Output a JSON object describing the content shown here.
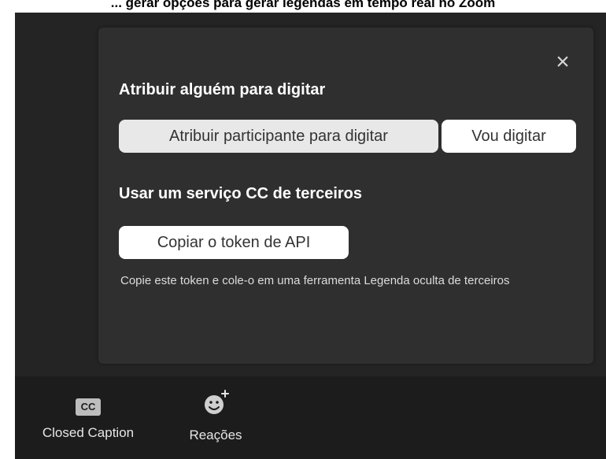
{
  "top_caption": "... gerar opções para gerar legendas em tempo real no Zoom",
  "panel": {
    "close_symbol": "×",
    "assign_heading": "Atribuir alguém para digitar",
    "assign_button_label": "Atribuir participante para digitar",
    "self_button_label": "Vou digitar",
    "third_party_heading": "Usar um serviço CC de terceiros",
    "copy_token_label": "Copiar o token de API",
    "helper_text": "Copie este token e cole-o em uma ferramenta Legenda oculta de terceiros"
  },
  "toolbar": {
    "cc_icon_text": "CC",
    "cc_label": "Closed Caption",
    "reactions_icon": "emoji-add-icon",
    "reactions_label": "Reações"
  },
  "colors": {
    "frame": "#242424",
    "panel": "#2f2f2f",
    "toolbar": "#1c1c1c",
    "button_light": "#ffffff",
    "button_grey": "#e8e8e8"
  }
}
